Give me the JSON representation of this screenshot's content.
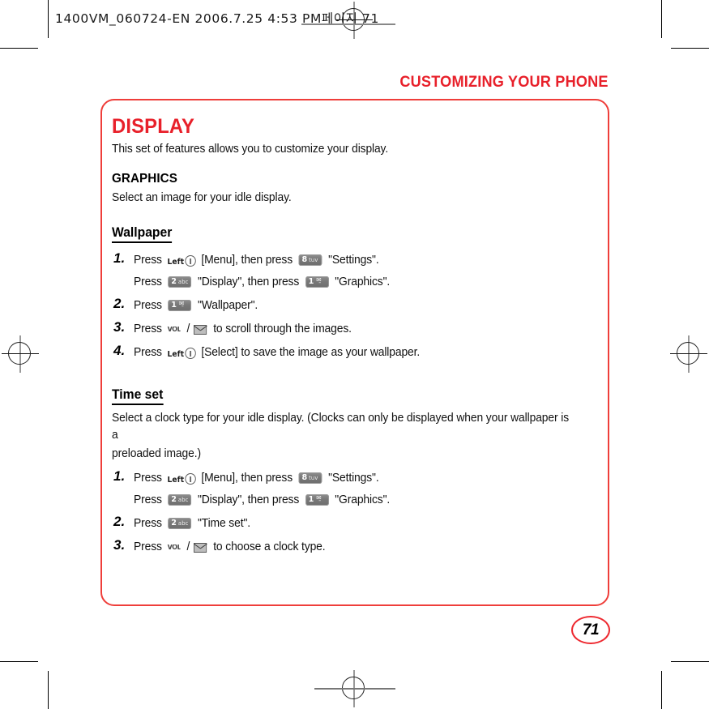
{
  "marks": {
    "registration_icon": "registration-crosshair-icon"
  },
  "slug": {
    "text": "1400VM_060724-EN  2006.7.25 4:53 PM",
    "korean": "페이지 71"
  },
  "running_head": {
    "title": "CUSTOMIZING YOUR PHONE"
  },
  "colors": {
    "brand_red": "#e8202a",
    "panel_border": "#ef3e3a",
    "text": "#111111"
  },
  "panel": {
    "section_title": "DISPLAY",
    "section_intro": "This set of features allows you to customize your display.",
    "graphics": {
      "heading": "GRAPHICS",
      "intro": "Select an image for your idle display."
    },
    "wallpaper": {
      "heading": "Wallpaper",
      "steps": [
        {
          "num": "1.",
          "lines": [
            {
              "segments": [
                {
                  "type": "text",
                  "value": "Press"
                },
                {
                  "type": "softkey",
                  "label": "Left"
                },
                {
                  "type": "text",
                  "value": "[Menu], then press"
                },
                {
                  "type": "keycap",
                  "digit": "8",
                  "letters": "tuv"
                },
                {
                  "type": "text",
                  "value": "\"Settings\"."
                }
              ]
            },
            {
              "segments": [
                {
                  "type": "text",
                  "value": "Press"
                },
                {
                  "type": "keycap",
                  "digit": "2",
                  "letters": "abc"
                },
                {
                  "type": "text",
                  "value": "\"Display\", then press"
                },
                {
                  "type": "keycap",
                  "digit": "1",
                  "letters": "✉̱"
                },
                {
                  "type": "text",
                  "value": "\"Graphics\"."
                }
              ]
            }
          ]
        },
        {
          "num": "2.",
          "lines": [
            {
              "segments": [
                {
                  "type": "text",
                  "value": "Press"
                },
                {
                  "type": "keycap",
                  "digit": "1",
                  "letters": "✉̱"
                },
                {
                  "type": "text",
                  "value": "\"Wallpaper\"."
                }
              ]
            }
          ]
        },
        {
          "num": "3.",
          "lines": [
            {
              "segments": [
                {
                  "type": "text",
                  "value": "Press"
                },
                {
                  "type": "volkey",
                  "label": "VOL"
                },
                {
                  "type": "slash",
                  "value": "/"
                },
                {
                  "type": "msgkey",
                  "label": "message-key"
                },
                {
                  "type": "text",
                  "value": "to scroll through the images."
                }
              ]
            }
          ]
        },
        {
          "num": "4.",
          "lines": [
            {
              "segments": [
                {
                  "type": "text",
                  "value": "Press"
                },
                {
                  "type": "softkey",
                  "label": "Left"
                },
                {
                  "type": "text",
                  "value": "[Select] to save the image as your wallpaper."
                }
              ]
            }
          ]
        }
      ]
    },
    "time_set": {
      "heading": "Time set",
      "intro_line1": "Select a clock type for your idle display.  (Clocks can only be displayed when your wallpaper is a",
      "intro_line2": "preloaded image.)",
      "steps": [
        {
          "num": "1.",
          "lines": [
            {
              "segments": [
                {
                  "type": "text",
                  "value": "Press"
                },
                {
                  "type": "softkey",
                  "label": "Left"
                },
                {
                  "type": "text",
                  "value": "[Menu], then press"
                },
                {
                  "type": "keycap",
                  "digit": "8",
                  "letters": "tuv"
                },
                {
                  "type": "text",
                  "value": "\"Settings\"."
                }
              ]
            },
            {
              "segments": [
                {
                  "type": "text",
                  "value": "Press"
                },
                {
                  "type": "keycap",
                  "digit": "2",
                  "letters": "abc"
                },
                {
                  "type": "text",
                  "value": "\"Display\", then press"
                },
                {
                  "type": "keycap",
                  "digit": "1",
                  "letters": "✉̱"
                },
                {
                  "type": "text",
                  "value": "\"Graphics\"."
                }
              ]
            }
          ]
        },
        {
          "num": "2.",
          "lines": [
            {
              "segments": [
                {
                  "type": "text",
                  "value": "Press"
                },
                {
                  "type": "keycap",
                  "digit": "2",
                  "letters": "abc"
                },
                {
                  "type": "text",
                  "value": "\"Time set\"."
                }
              ]
            }
          ]
        },
        {
          "num": "3.",
          "lines": [
            {
              "segments": [
                {
                  "type": "text",
                  "value": "Press"
                },
                {
                  "type": "volkey",
                  "label": "VOL"
                },
                {
                  "type": "slash",
                  "value": "/"
                },
                {
                  "type": "msgkey",
                  "label": "message-key"
                },
                {
                  "type": "text",
                  "value": "to choose a clock type."
                }
              ]
            }
          ]
        }
      ]
    }
  },
  "page_number": "71"
}
